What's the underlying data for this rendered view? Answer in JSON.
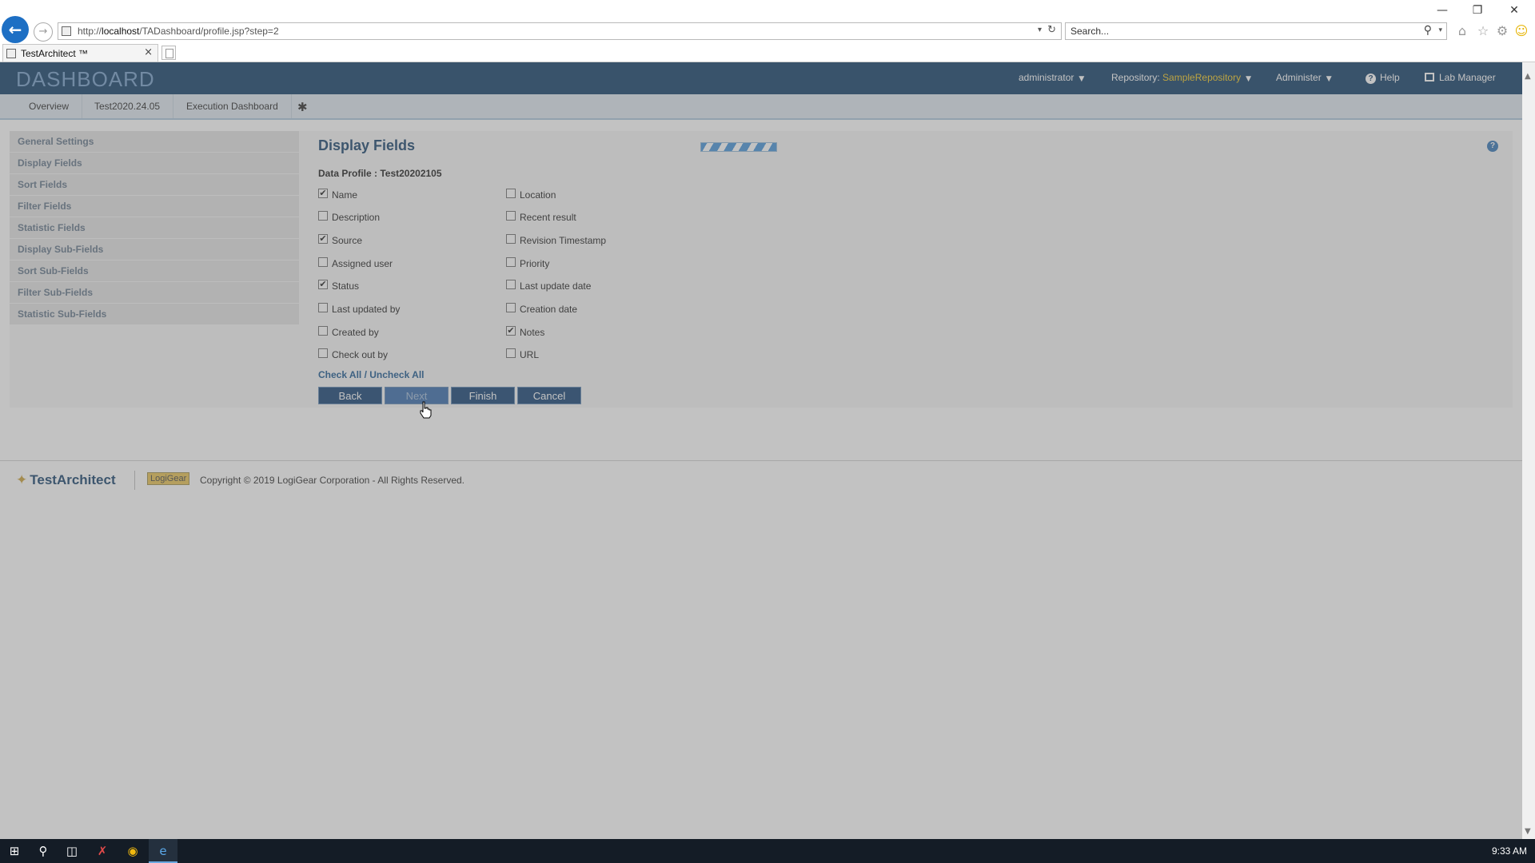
{
  "browser": {
    "url_prefix": "http://",
    "url_host": "localhost",
    "url_path": "/TADashboard/profile.jsp?step=2",
    "search_placeholder": "Search...",
    "tab_title": "TestArchitect ™",
    "window_controls": [
      "minimize-icon",
      "restore-icon",
      "close-icon"
    ]
  },
  "header": {
    "logo": "DASHBOARD",
    "user": "administrator",
    "repository_label": "Repository:",
    "repository_value": "SampleRepository",
    "administer": "Administer",
    "help": "Help",
    "lab_manager": "Lab Manager",
    "accent_color": "#f3c617"
  },
  "nav": {
    "tabs": [
      "Overview",
      "Test2020.24.05",
      "Execution Dashboard"
    ]
  },
  "sidebar": {
    "items": [
      "General Settings",
      "Display Fields",
      "Sort Fields",
      "Filter Fields",
      "Statistic Fields",
      "Display Sub-Fields",
      "Sort Sub-Fields",
      "Filter Sub-Fields",
      "Statistic Sub-Fields"
    ]
  },
  "panel": {
    "title": "Display Fields",
    "profile_label": "Data Profile : Test20202105",
    "left_fields": [
      {
        "label": "Name",
        "checked": true
      },
      {
        "label": "Description",
        "checked": false
      },
      {
        "label": "Source",
        "checked": true
      },
      {
        "label": "Assigned user",
        "checked": false
      },
      {
        "label": "Status",
        "checked": true
      },
      {
        "label": "Last updated by",
        "checked": false
      },
      {
        "label": "Created by",
        "checked": false
      },
      {
        "label": "Check out by",
        "checked": false
      }
    ],
    "right_fields": [
      {
        "label": "Location",
        "checked": false
      },
      {
        "label": "Recent result",
        "checked": false
      },
      {
        "label": "Revision Timestamp",
        "checked": false
      },
      {
        "label": "Priority",
        "checked": false
      },
      {
        "label": "Last update date",
        "checked": false
      },
      {
        "label": "Creation date",
        "checked": false
      },
      {
        "label": "Notes",
        "checked": true
      },
      {
        "label": "URL",
        "checked": false
      }
    ],
    "check_all": "Check All / Uncheck All",
    "buttons": {
      "back": "Back",
      "next": "Next",
      "finish": "Finish",
      "cancel": "Cancel"
    }
  },
  "footer": {
    "brand": "TestArchitect",
    "partner": "LogiGear",
    "copyright": "Copyright © 2019 LogiGear Corporation - All Rights Reserved."
  },
  "taskbar": {
    "clock": "9:33 AM"
  }
}
